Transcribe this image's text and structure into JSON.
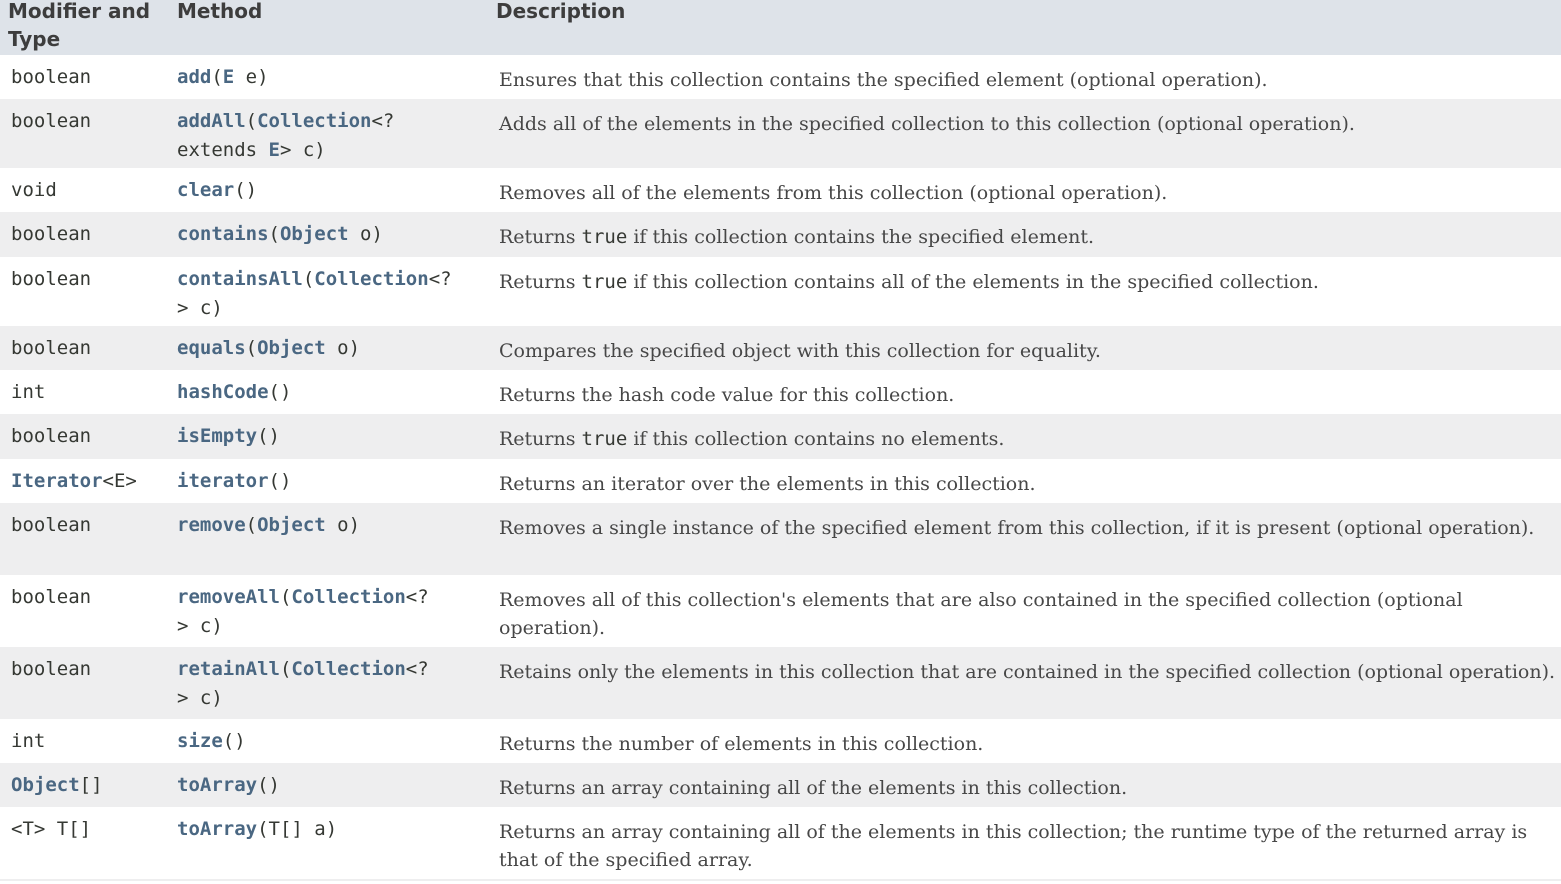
{
  "headers": {
    "modifier_type": "Modifier and Type",
    "method": "Method",
    "description": "Description"
  },
  "rows": [
    {
      "type": "boolean",
      "name": "add",
      "p1": "(",
      "p1link": "E",
      "p2": " e)",
      "desc": "Ensures that this collection contains the specified element (optional operation)."
    },
    {
      "type": "boolean",
      "name": "addAll",
      "p1": "(",
      "p1link": "Collection",
      "p2": "<?",
      "p3": "extends ",
      "p3link": "E",
      "p4": "> c)",
      "desc": "Adds all of the elements in the specified collection to this collection (optional operation)."
    },
    {
      "type": "void",
      "name": "clear",
      "p1": "()",
      "desc": "Removes all of the elements from this collection (optional operation)."
    },
    {
      "type": "boolean",
      "name": "contains",
      "p1": "(",
      "p1link": "Object",
      "p2": " o)",
      "desc_a": "Returns ",
      "desc_code": "true",
      "desc_b": " if this collection contains the specified element."
    },
    {
      "type": "boolean",
      "name": "containsAll",
      "p1": "(",
      "p1link": "Collection",
      "p2": "<?",
      "p3": "> c)",
      "desc_a": "Returns ",
      "desc_code": "true",
      "desc_b": " if this collection contains all of the elements in the specified collection."
    },
    {
      "type": "boolean",
      "name": "equals",
      "p1": "(",
      "p1link": "Object",
      "p2": " o)",
      "desc": "Compares the specified object with this collection for equality."
    },
    {
      "type": "int",
      "name": "hashCode",
      "p1": "()",
      "desc": "Returns the hash code value for this collection."
    },
    {
      "type": "boolean",
      "name": "isEmpty",
      "p1": "()",
      "desc_a": "Returns ",
      "desc_code": "true",
      "desc_b": " if this collection contains no elements."
    },
    {
      "type_link": "Iterator",
      "type_rest": "<E>",
      "name": "iterator",
      "p1": "()",
      "desc": "Returns an iterator over the elements in this collection."
    },
    {
      "type": "boolean",
      "name": "remove",
      "p1": "(",
      "p1link": "Object",
      "p2": " o)",
      "desc": "Removes a single instance of the specified element from this collection, if it is present (optional operation)."
    },
    {
      "type": "boolean",
      "name": "removeAll",
      "p1": "(",
      "p1link": "Collection",
      "p2": "<?",
      "p3": "> c)",
      "desc": "Removes all of this collection's elements that are also contained in the specified collection (optional operation)."
    },
    {
      "type": "boolean",
      "name": "retainAll",
      "p1": "(",
      "p1link": "Collection",
      "p2": "<?",
      "p3": "> c)",
      "desc": "Retains only the elements in this collection that are contained in the specified collection (optional operation)."
    },
    {
      "type": "int",
      "name": "size",
      "p1": "()",
      "desc": "Returns the number of elements in this collection."
    },
    {
      "type_link": "Object",
      "type_rest": "[]",
      "name": "toArray",
      "p1": "()",
      "desc": "Returns an array containing all of the elements in this collection."
    },
    {
      "type": "<T> T[]",
      "name": "toArray",
      "p1": "(T[] a)",
      "desc": "Returns an array containing all of the elements in this collection; the runtime type of the returned array is that of the specified array."
    }
  ]
}
